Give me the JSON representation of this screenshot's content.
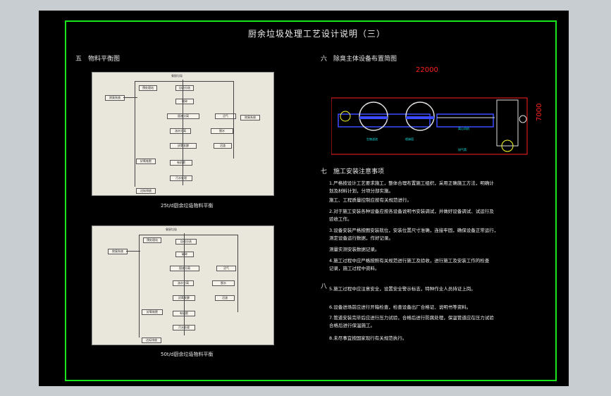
{
  "title": "厨余垃圾处理工艺设计说明（三）",
  "section_5": "五　物料平衡图",
  "section_6": "六　除臭主体设备布置简图",
  "section_7": "七　施工安装注意事项",
  "section_8_label": "八",
  "caption_1": "25t/d厨余垃圾物料平衡",
  "caption_2": "50t/d厨余垃圾物料平衡",
  "flow_1": {
    "top_label": "餐厨垃圾",
    "nodes": [
      "预处理站",
      "自动分选",
      "破碎",
      "固液分离",
      "油水分离",
      "厌氧发酵",
      "沼气",
      "脱水",
      "沼渣",
      "好氧堆肥",
      "有机肥",
      "污水处理",
      "达标排放",
      "除臭系统"
    ],
    "left_box": "除臭系统"
  },
  "flow_2": {
    "top_label": "餐厨垃圾",
    "nodes": [
      "预处理站",
      "自动分选",
      "破碎",
      "固液分离",
      "油水分离",
      "厌氧发酵",
      "沼气",
      "脱水",
      "沼渣",
      "好氧堆肥",
      "有机肥",
      "污水处理",
      "达标排放"
    ],
    "left_box": "除臭系统"
  },
  "dimensions": {
    "length": "22000",
    "height": "7000"
  },
  "layout_labels": [
    "生物滤池",
    "喷淋塔",
    "离心风机",
    "排气筒"
  ],
  "notes": [
    "1.严格按设计工艺要求施工，整体合理布置施工组织，采用正确施工方法，明确计",
    "划及材料计划，分项分部实施。",
    "施工、工程质量控制应按有关规范进行。",
    "2.对于施工安装各种设备应按各设备说明书安装调试，并做好设备调试、试运行及",
    "验收工作。",
    "3.设备安装严格按图安装就位，安装位置尺寸准确，连接牢固，确保设备正常运行，",
    "测定设备运行数据，作好记录。",
    "测量实测安装数据记录。",
    "4.施工过程中应严格按照有关规范进行施工及验收，进行施工及安装工作的检查",
    "记录，施工过程中资料。",
    "5.施工过程中应注意安全，设置安全警示标志，特种作业人员持证上岗。",
    "6.设备进场前应进行开箱检查，检查设备出厂合格证、说明书等资料。",
    "7.管道安装完毕后应进行压力试验，合格后进行防腐处理，保温管道应在压力试验",
    "合格后进行保温施工。",
    "8.未尽事宜按国家现行有关规范执行。"
  ],
  "colors": {
    "border": "#19e619",
    "background": "#000000",
    "dimension": "#ff2020",
    "equipment": "#3a4bff"
  }
}
